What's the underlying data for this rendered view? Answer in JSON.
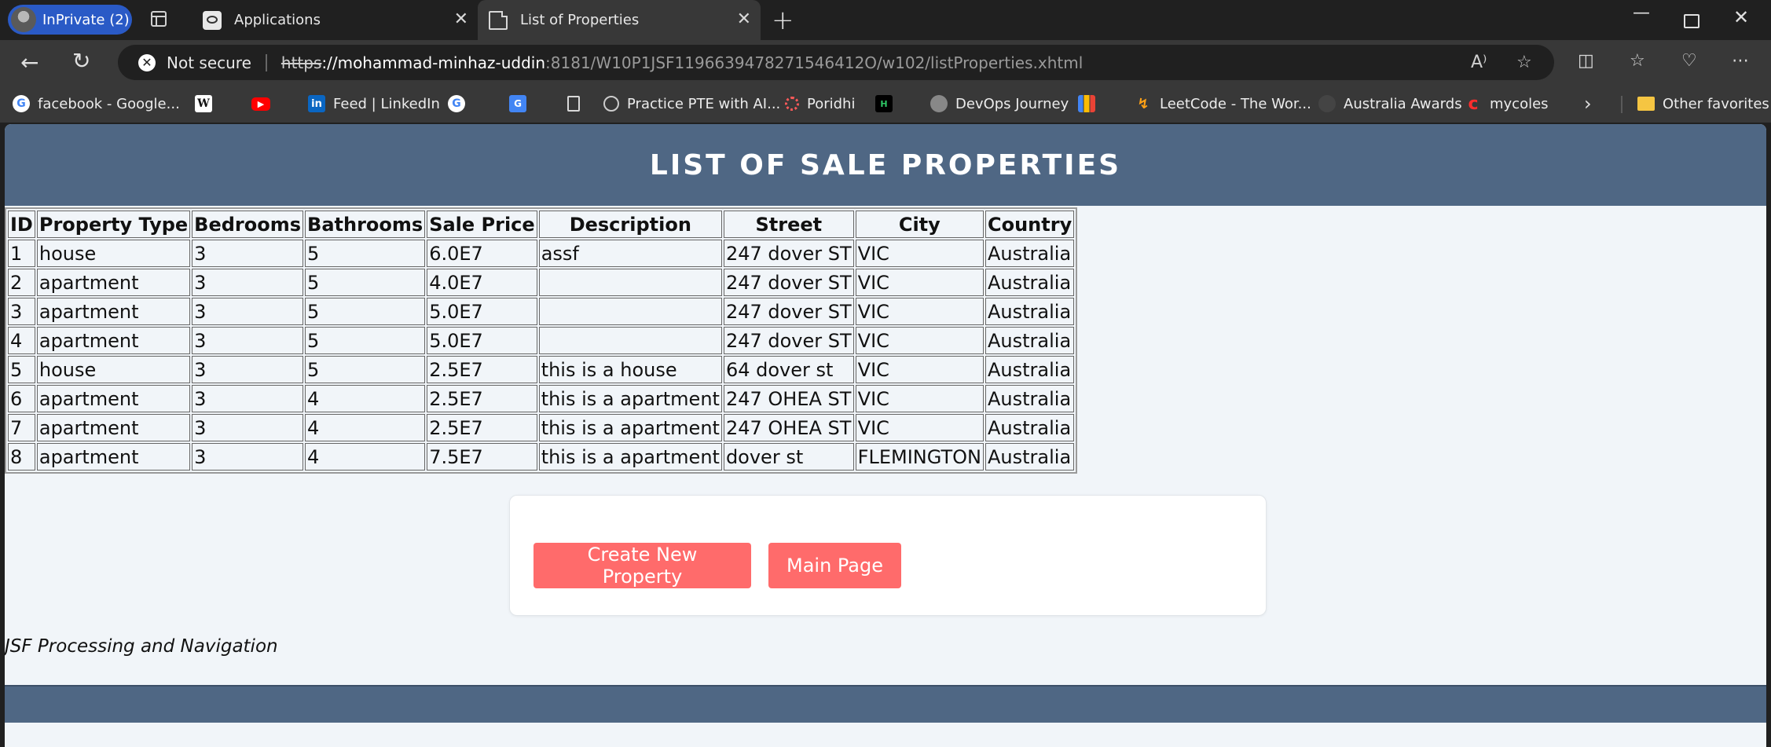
{
  "browser": {
    "profile_label": "InPrivate (2)",
    "tabs": [
      {
        "title": "Applications",
        "active": false
      },
      {
        "title": "List of Properties",
        "active": true
      }
    ],
    "security_label": "Not secure",
    "url": {
      "scheme": "https",
      "host_prefix": "://mohammad-minhaz-uddin",
      "rest": ":8181/W10P1JSF1196639478271546412O/w102/listProperties.xhtml"
    },
    "bookmarks": [
      {
        "label": "facebook - Google...",
        "icon": "google-icon"
      },
      {
        "label": "",
        "icon": "wikipedia-icon"
      },
      {
        "label": "",
        "icon": "youtube-icon"
      },
      {
        "label": "Feed | LinkedIn",
        "icon": "linkedin-icon"
      },
      {
        "label": "",
        "icon": "google-icon"
      },
      {
        "label": "",
        "icon": "google-translate-icon"
      },
      {
        "label": "",
        "icon": "document-icon"
      },
      {
        "label": "Practice PTE with AI...",
        "icon": "pte-icon"
      },
      {
        "label": "Poridhi",
        "icon": "poridhi-icon"
      },
      {
        "label": "",
        "icon": "hackerrank-icon"
      },
      {
        "label": "DevOps Journey",
        "icon": "devops-icon"
      },
      {
        "label": "",
        "icon": "bar-chart-icon"
      },
      {
        "label": "LeetCode - The Wor...",
        "icon": "leetcode-icon"
      },
      {
        "label": "Australia Awards",
        "icon": "australia-awards-icon"
      },
      {
        "label": "mycoles",
        "icon": "coles-icon"
      }
    ],
    "other_favorites": "Other favorites"
  },
  "page": {
    "header_title": "LIST OF SALE PROPERTIES",
    "table": {
      "columns": [
        "ID",
        "Property Type",
        "Bedrooms",
        "Bathrooms",
        "Sale Price",
        "Description",
        "Street",
        "City",
        "Country"
      ],
      "rows": [
        [
          "1",
          "house",
          "3",
          "5",
          "6.0E7",
          "assf",
          "247 dover ST",
          "VIC",
          "Australia"
        ],
        [
          "2",
          "apartment",
          "3",
          "5",
          "4.0E7",
          "",
          "247 dover ST",
          "VIC",
          "Australia"
        ],
        [
          "3",
          "apartment",
          "3",
          "5",
          "5.0E7",
          "",
          "247 dover ST",
          "VIC",
          "Australia"
        ],
        [
          "4",
          "apartment",
          "3",
          "5",
          "5.0E7",
          "",
          "247 dover ST",
          "VIC",
          "Australia"
        ],
        [
          "5",
          "house",
          "3",
          "5",
          "2.5E7",
          "this is a house",
          "64 dover st",
          "VIC",
          "Australia"
        ],
        [
          "6",
          "apartment",
          "3",
          "4",
          "2.5E7",
          "this is a apartment",
          "247 OHEA ST",
          "VIC",
          "Australia"
        ],
        [
          "7",
          "apartment",
          "3",
          "4",
          "2.5E7",
          "this is a apartment",
          "247 OHEA ST",
          "VIC",
          "Australia"
        ],
        [
          "8",
          "apartment",
          "3",
          "4",
          "7.5E7",
          "this is a apartment",
          "dover st",
          "FLEMINGTON",
          "Australia"
        ]
      ]
    },
    "buttons": {
      "create": "Create New Property",
      "main": "Main Page"
    },
    "footer_text": "JSF Processing and Navigation"
  },
  "colors": {
    "header_bg": "#4f6784",
    "button_bg": "#ff6b6b",
    "page_bg": "#f1f5f9"
  }
}
